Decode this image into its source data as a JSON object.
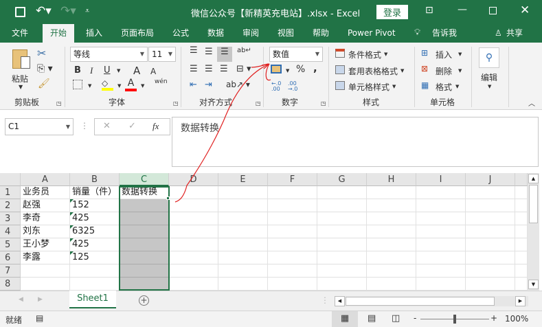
{
  "titlebar": {
    "title": "微信公众号【新精英充电站】.xlsx  -  Excel",
    "login": "登录"
  },
  "tabs": [
    "文件",
    "开始",
    "插入",
    "页面布局",
    "公式",
    "数据",
    "审阅",
    "视图",
    "帮助",
    "Power Pivot",
    "告诉我",
    "共享"
  ],
  "ribbon": {
    "clipboard": {
      "paste": "粘贴",
      "label": "剪贴板"
    },
    "font": {
      "name": "等线",
      "size": "11",
      "bold": "B",
      "italic": "I",
      "underline": "U",
      "grow": "A",
      "shrink": "A",
      "label": "字体",
      "phonetic": "wén"
    },
    "alignment": {
      "label": "对齐方式"
    },
    "number": {
      "format": "数值",
      "percent": "%",
      "comma": ",",
      "label": "数字"
    },
    "styles": {
      "conditional": "条件格式",
      "table": "套用表格格式",
      "cell": "单元格样式",
      "label": "样式"
    },
    "cells": {
      "insert": "插入",
      "delete": "删除",
      "format": "格式",
      "label": "单元格"
    },
    "editing": {
      "label": "编辑"
    }
  },
  "formula": {
    "namebox": "C1",
    "cancel": "✕",
    "enter": "✓",
    "fx": "fx",
    "content": "数据转换"
  },
  "sheet": {
    "columns": [
      "A",
      "B",
      "C",
      "D",
      "E",
      "F",
      "G",
      "H",
      "I",
      "J"
    ],
    "rows": [
      [
        "业务员",
        "销量（件）",
        "数据转换"
      ],
      [
        "赵强",
        "152",
        ""
      ],
      [
        "李奇",
        "425",
        ""
      ],
      [
        "刘东",
        "6325",
        ""
      ],
      [
        "王小梦",
        "425",
        ""
      ],
      [
        "李露",
        "125",
        ""
      ],
      [
        "",
        "",
        ""
      ],
      [
        "",
        "",
        ""
      ]
    ],
    "selected_column": "C"
  },
  "sheet_tabs": [
    "Sheet1"
  ],
  "status": {
    "ready": "就绪",
    "zoom": "100%"
  },
  "colors": {
    "brand": "#217346",
    "annotation": "#e02020"
  }
}
